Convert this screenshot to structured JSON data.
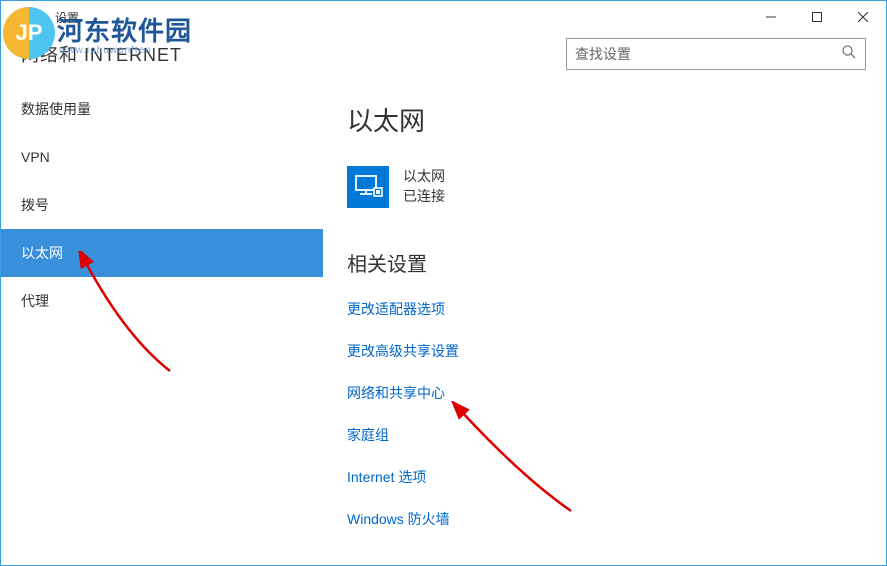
{
  "window": {
    "title": "设置"
  },
  "header": {
    "page_heading": "网络和 INTERNET",
    "search_placeholder": "查找设置"
  },
  "sidebar": {
    "items": [
      {
        "label": "数据使用量",
        "selected": false
      },
      {
        "label": "VPN",
        "selected": false
      },
      {
        "label": "拨号",
        "selected": false
      },
      {
        "label": "以太网",
        "selected": true
      },
      {
        "label": "代理",
        "selected": false
      }
    ]
  },
  "main": {
    "section_title": "以太网",
    "network": {
      "name": "以太网",
      "status": "已连接"
    },
    "related_title": "相关设置",
    "links": [
      "更改适配器选项",
      "更改高级共享设置",
      "网络和共享中心",
      "家庭组",
      "Internet 选项",
      "Windows 防火墙"
    ]
  },
  "watermark": {
    "text": "河东软件园",
    "sub": "www.ipbuwanften"
  }
}
